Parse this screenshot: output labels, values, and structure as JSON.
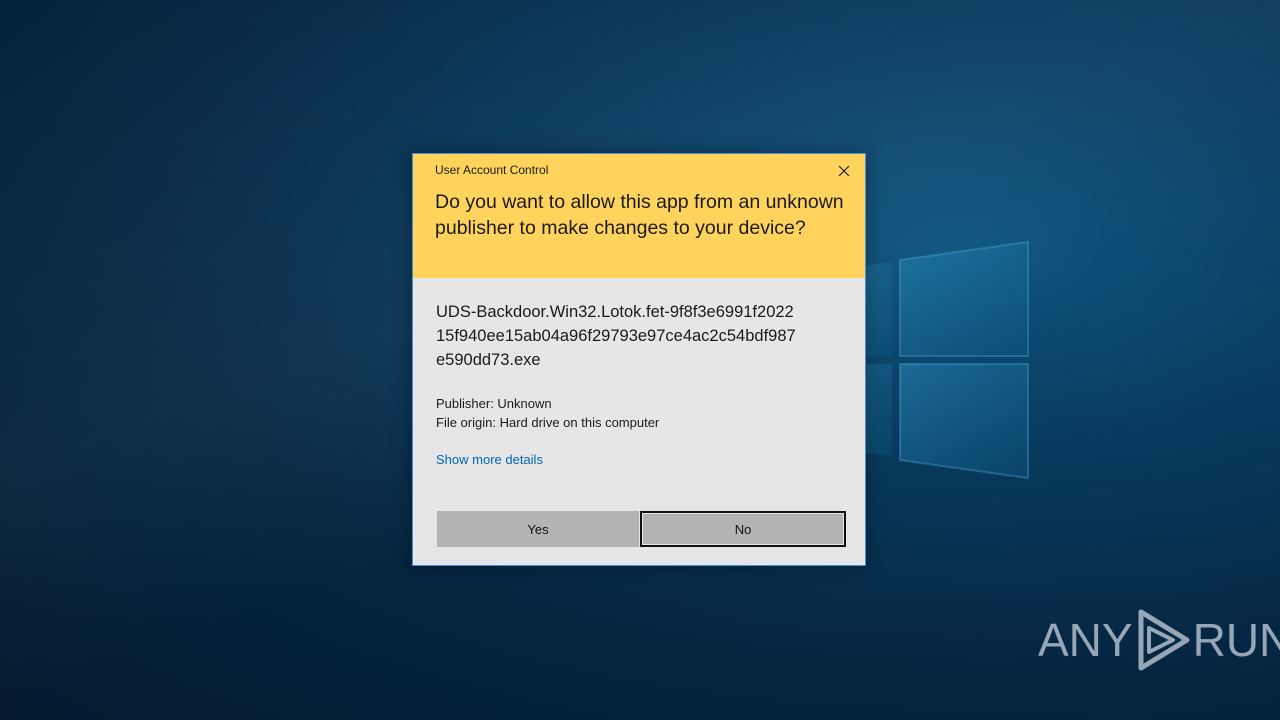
{
  "dialog": {
    "title": "User Account Control",
    "question": "Do you want to allow this app from an unknown publisher to make changes to your device?",
    "app_name": "UDS-Backdoor.Win32.Lotok.fet-9f8f3e6991f202215f940ee15ab04a96f29793e97ce4ac2c54bdf987e590dd73.exe",
    "publisher": "Publisher: Unknown",
    "file_origin": "File origin: Hard drive on this computer",
    "more_details_link": "Show more details",
    "yes_label": "Yes",
    "no_label": "No"
  },
  "watermark": {
    "left": "ANY",
    "right": "RUN"
  },
  "colors": {
    "header": "#ffd35c",
    "body": "#e6e6e6",
    "link": "#0067b8",
    "button": "#b3b3b3"
  }
}
